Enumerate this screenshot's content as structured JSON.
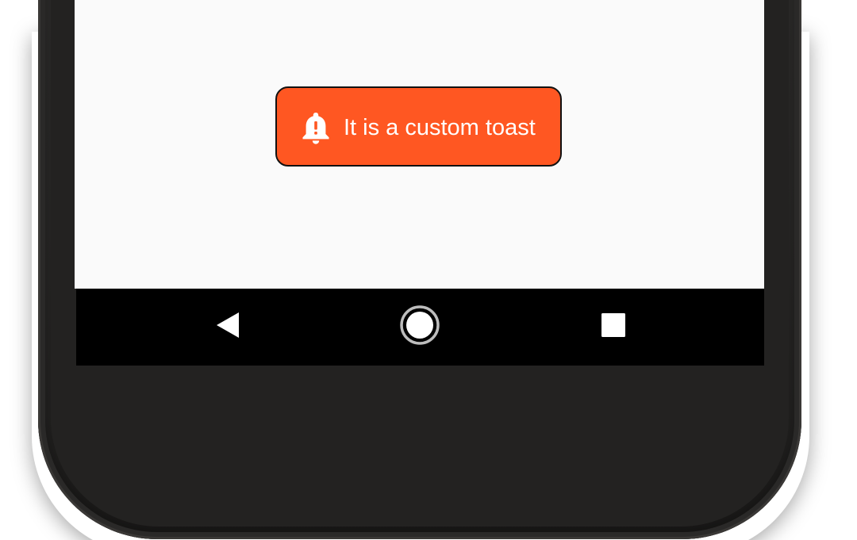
{
  "toast": {
    "icon": "bell-alert-icon",
    "message": "It is a custom toast",
    "background_color": "#ff5722",
    "text_color": "#ffffff"
  },
  "screen": {
    "background_color": "#fafafa"
  },
  "navigation_bar": {
    "buttons": [
      {
        "icon": "back-triangle-icon"
      },
      {
        "icon": "home-circle-icon"
      },
      {
        "icon": "recents-square-icon"
      }
    ]
  }
}
